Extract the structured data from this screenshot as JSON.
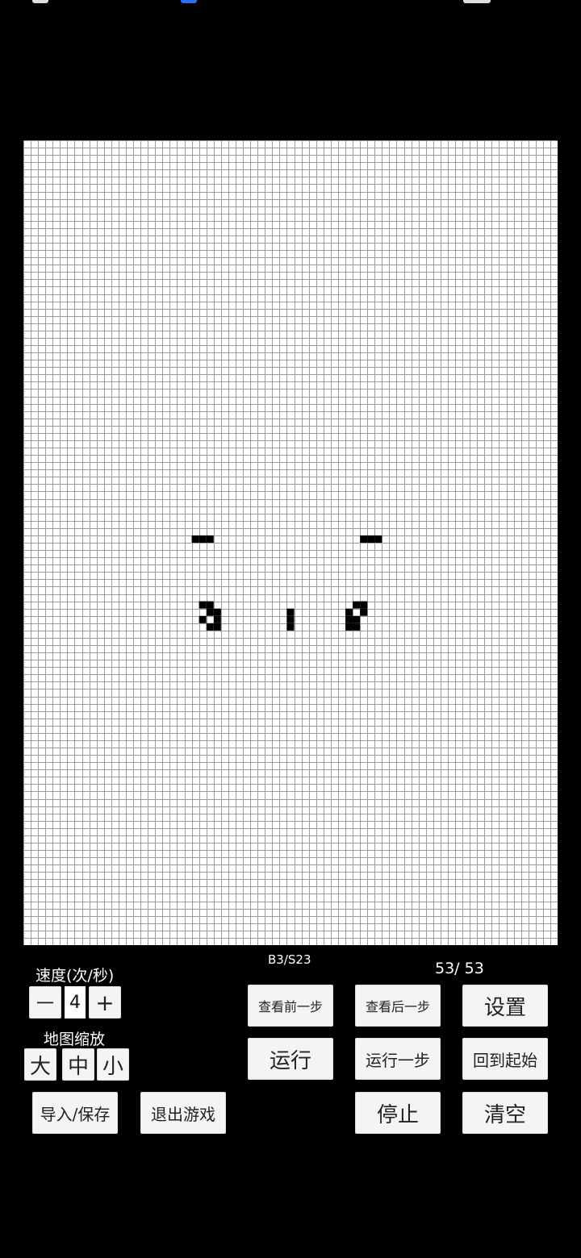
{
  "grid": {
    "cols": 73,
    "rows": 110,
    "line_color": "#9a9a9a",
    "live_color": "#000000",
    "live_cells": [
      [
        23,
        54
      ],
      [
        24,
        54
      ],
      [
        25,
        54
      ],
      [
        46,
        54
      ],
      [
        47,
        54
      ],
      [
        48,
        54
      ],
      [
        24,
        63
      ],
      [
        25,
        63
      ],
      [
        25,
        64
      ],
      [
        26,
        64
      ],
      [
        24,
        65
      ],
      [
        26,
        65
      ],
      [
        25,
        66
      ],
      [
        26,
        66
      ],
      [
        45,
        63
      ],
      [
        46,
        63
      ],
      [
        44,
        64
      ],
      [
        46,
        64
      ],
      [
        44,
        65
      ],
      [
        45,
        65
      ],
      [
        44,
        66
      ],
      [
        45,
        66
      ],
      [
        36,
        64
      ],
      [
        36,
        65
      ],
      [
        36,
        66
      ]
    ]
  },
  "rule_text": "B3/S23",
  "generation_counter": "53/ 53",
  "speed": {
    "label": "速度(次/秒)",
    "minus": "一",
    "value": "4",
    "plus": "+"
  },
  "zoom": {
    "label": "地图缩放",
    "large": "大",
    "medium": "中",
    "small": "小"
  },
  "buttons": {
    "prev_step": "查看前一步",
    "next_step": "查看后一步",
    "settings": "设置",
    "run": "运行",
    "run_one_step": "运行一步",
    "back_to_start": "回到起始",
    "import_save": "导入/保存",
    "exit_game": "退出游戏",
    "stop": "停止",
    "clear": "清空"
  }
}
